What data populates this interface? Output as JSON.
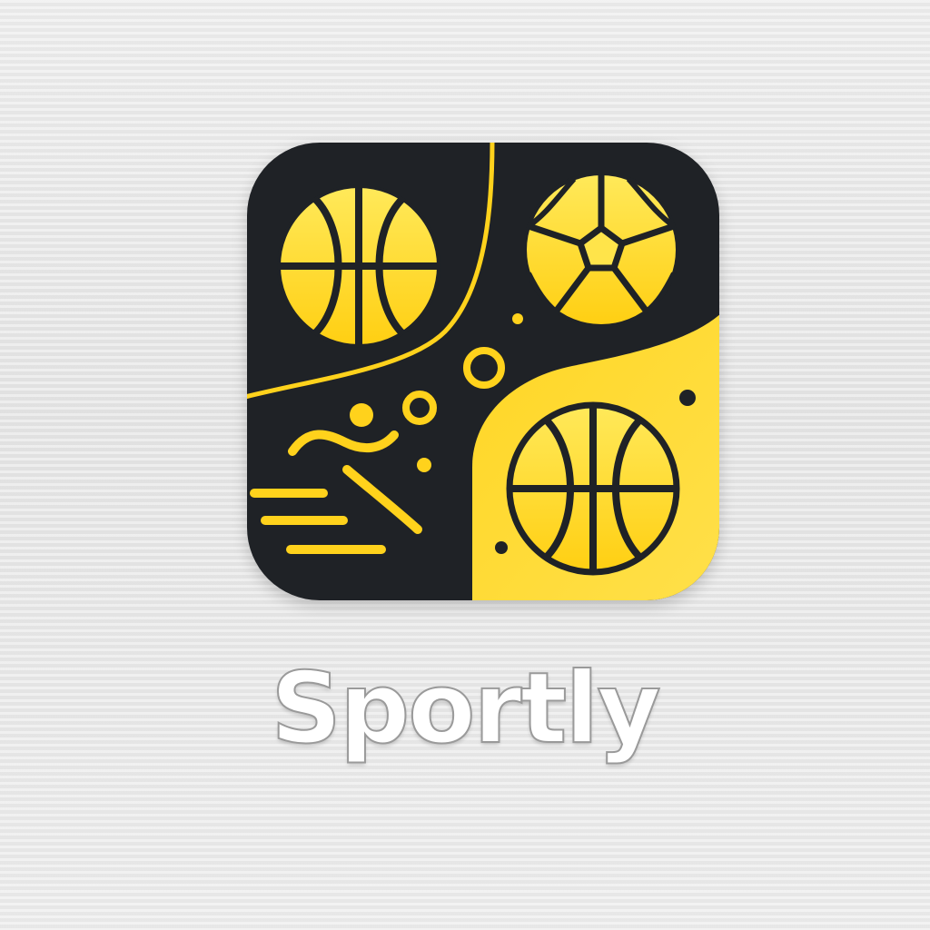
{
  "app": {
    "name": "Sportly"
  },
  "icon": {
    "semantic": "basketball-sports-app-icon",
    "elements": [
      "basketball-icon",
      "soccer-ball-icon",
      "basketball-icon",
      "running-athlete-icon"
    ]
  },
  "colors": {
    "dark": "#1f2226",
    "accent": "#ffd21c",
    "accent_light": "#ffe866",
    "label": "#ffffff"
  }
}
